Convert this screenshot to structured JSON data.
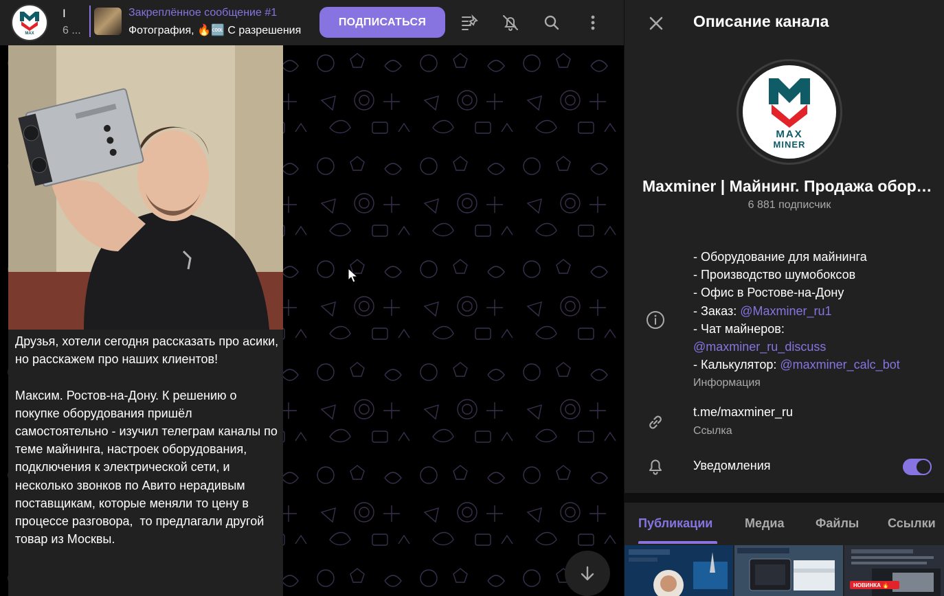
{
  "header": {
    "channel_title": "I",
    "channel_sub": "6 ...",
    "pinned_title": "Закреплённое сообщение #1",
    "pinned_text": "Фотография, 🔥🆒 С разрешения",
    "subscribe_label": "ПОДПИСАТЬСЯ"
  },
  "avatar_text": {
    "line1": "MAX",
    "line2": "MINER"
  },
  "message": {
    "text": "Друзья, хотели сегодня рассказать про асики, но расскажем про наших клиентов!\n\nМаксим. Ростов-на-Дону. К решению о покупке оборудования пришёл самостоятельно - изучил телеграм каналы по теме майнинга, настроек оборудования, подключения к электрической сети, и несколько звонков по Авито нерадивым поставщикам, которые меняли то цену в процессе разговора,  то предлагали другой товар из Москвы."
  },
  "info_panel": {
    "title": "Описание канала",
    "channel_name": "Maxminer | Майнинг. Продажа оборудования",
    "subscribers": "6 881 подписчик",
    "desc": {
      "line1": "- Оборудование для майнинга",
      "line2": "- Производство шумобоксов",
      "line3": "- Офис в Ростове-на-Дону",
      "order_prefix": "- Заказ: ",
      "order_link": "@Maxminer_ru1",
      "chat_prefix": "- Чат майнеров:",
      "chat_link": "@maxminer_ru_discuss",
      "calc_prefix": "- Калькулятор: ",
      "calc_link": "@maxminer_calc_bot"
    },
    "info_label": "Информация",
    "link": "t.me/maxminer_ru",
    "link_label": "Ссылка",
    "notifications_label": "Уведомления",
    "notifications_on": true,
    "tabs": [
      "Публикации",
      "Медиа",
      "Файлы",
      "Ссылки"
    ],
    "active_tab": "Публикации",
    "thumb_badge": "НОВИНКА 🔥"
  },
  "colors": {
    "accent": "#8774e1",
    "panel": "#212121",
    "background": "#000000",
    "logo_red": "#e3232a",
    "logo_teal": "#0f5b66"
  }
}
